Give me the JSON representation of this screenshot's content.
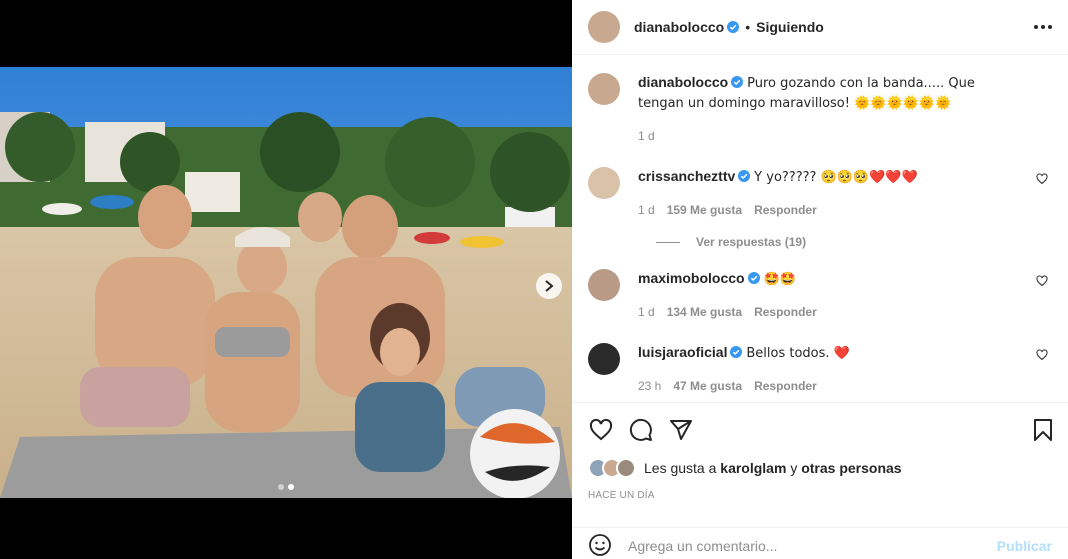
{
  "post": {
    "author": "dianabolocco",
    "follow_status": "Siguiendo",
    "separator": "•",
    "caption": "Puro gozando con la banda..... Que tengan un domingo maravilloso! 🌞🌞🌞🌞🌞🌞",
    "caption_age": "1 d",
    "liked_by_prefix": "Les gusta a",
    "liked_by_user": "karolglam",
    "liked_by_suffix": "y",
    "liked_by_others": "otras personas",
    "posted_ago": "HACE UN DÍA"
  },
  "comments": [
    {
      "user": "crissanchezttv",
      "text": "Y yo????? 🥺🥺🥺❤️❤️❤️",
      "age": "1 d",
      "likes": "159 Me gusta",
      "reply": "Responder",
      "view_replies": "Ver respuestas (19)"
    },
    {
      "user": "maximobolocco",
      "text": "🤩🤩",
      "age": "1 d",
      "likes": "134 Me gusta",
      "reply": "Responder"
    },
    {
      "user": "luisjaraoficial",
      "text": "Bellos todos. ❤️",
      "age": "23 h",
      "likes": "47 Me gusta",
      "reply": "Responder"
    }
  ],
  "composer": {
    "placeholder": "Agrega un comentario...",
    "submit_label": "Publicar"
  },
  "colors": {
    "verified": "#3897f0",
    "heart_red": "#ed4956",
    "publish_disabled": "#b2dffc",
    "meta_gray": "#8e8e8e"
  },
  "icons": [
    "verified-badge-icon",
    "more-options-icon",
    "heart-icon",
    "comment-icon",
    "share-icon",
    "bookmark-icon",
    "emoji-icon",
    "chevron-right-icon"
  ]
}
